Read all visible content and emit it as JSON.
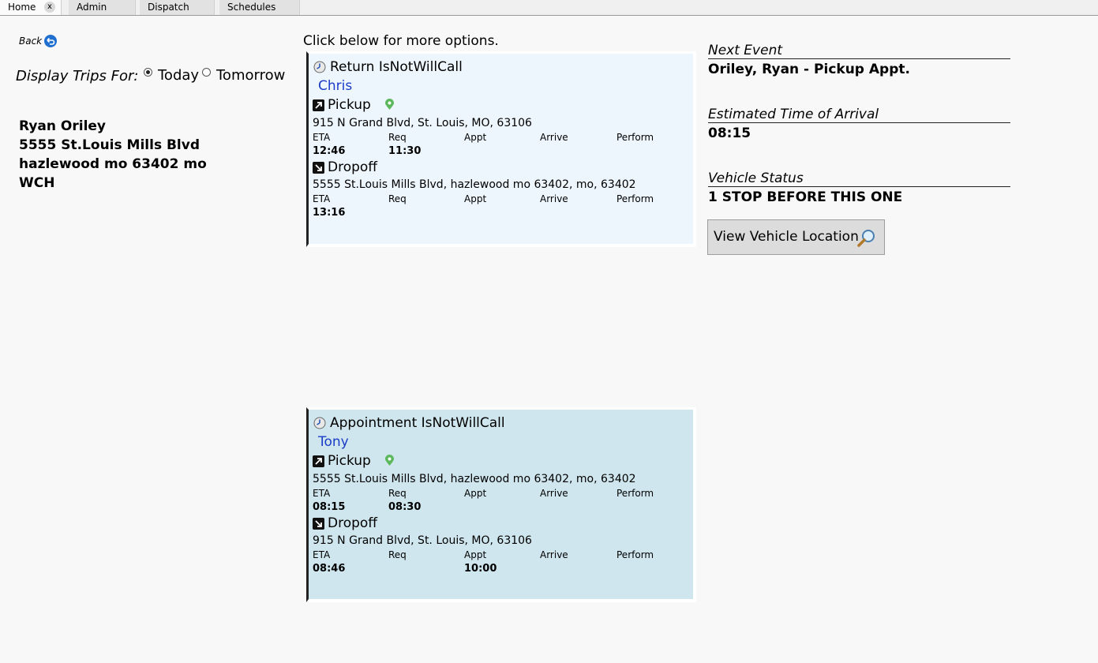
{
  "tabs": [
    {
      "label": "Home",
      "close": "x"
    },
    {
      "label": "Admin"
    },
    {
      "label": "Dispatch"
    },
    {
      "label": "Schedules"
    }
  ],
  "left": {
    "back_label": "Back",
    "display_label": "Display Trips For:",
    "today_label": "Today",
    "tomorrow_label": "Tomorrow",
    "selected": "Today",
    "rider_lines": [
      "Ryan  Oriley",
      "5555 St.Louis Mills Blvd",
      "hazlewood mo 63402   mo",
      "WCH"
    ]
  },
  "click_hint": "Click below for more options.",
  "column_headers": {
    "eta": "ETA",
    "req": "Req",
    "appt": "Appt",
    "arrive": "Arrive",
    "perform": "Perform"
  },
  "trips": [
    {
      "type": "Return  IsNotWillCall",
      "driver": "Chris",
      "pickup": {
        "label": "Pickup",
        "address": "915 N Grand Blvd, St. Louis, MO, 63106",
        "eta": "12:46",
        "req": "11:30",
        "appt": "",
        "arrive": "",
        "perform": ""
      },
      "dropoff": {
        "label": "Dropoff",
        "address": "5555 St.Louis Mills Blvd, hazlewood mo 63402, mo, 63402",
        "eta": "13:16",
        "req": "",
        "appt": "",
        "arrive": "",
        "perform": ""
      }
    },
    {
      "type": "Appointment  IsNotWillCall",
      "driver": "Tony",
      "pickup": {
        "label": "Pickup",
        "address": "5555 St.Louis Mills Blvd, hazlewood mo 63402, mo, 63402",
        "eta": "08:15",
        "req": "08:30",
        "appt": "",
        "arrive": "",
        "perform": ""
      },
      "dropoff": {
        "label": "Dropoff",
        "address": "915 N Grand Blvd, St. Louis, MO, 63106",
        "eta": "08:46",
        "req": "",
        "appt": "10:00",
        "arrive": "",
        "perform": ""
      }
    }
  ],
  "right": {
    "next_event_label": "Next Event",
    "next_event_value": "Oriley, Ryan - Pickup Appt.",
    "eta_label": "Estimated Time of Arrival",
    "eta_value": "08:15",
    "status_label": "Vehicle Status",
    "status_value": "1 STOP BEFORE THIS ONE",
    "view_location_label": "View Vehicle Location"
  },
  "colors": {
    "driver": "#1a3cc8",
    "card1_bg": "#eef6fd",
    "card2_bg": "#cfe6ee",
    "pin": "#5cb85c"
  }
}
